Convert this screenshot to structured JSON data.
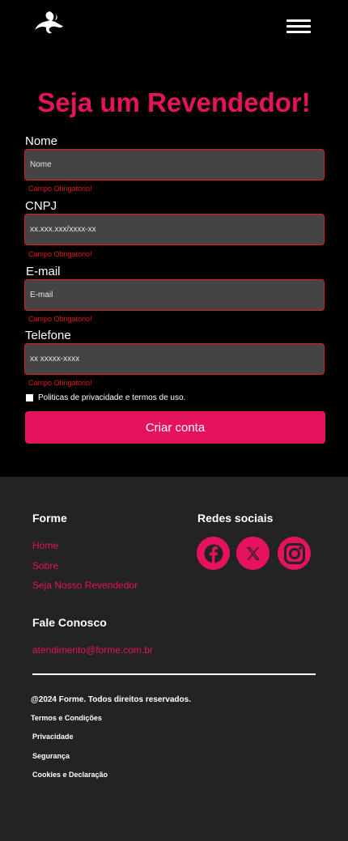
{
  "header": {
    "logo_icon": "brand-swirl-logo",
    "menu_icon": "hamburger-menu-icon"
  },
  "form": {
    "title": "Seja um Revendedor!",
    "fields": [
      {
        "label": "Nome",
        "placeholder": "Nome",
        "error": "Campo Obrigatório!"
      },
      {
        "label": "CNPJ",
        "placeholder": "xx.xxx.xxx/xxxx-xx",
        "error": "Campo Obrigatório!"
      },
      {
        "label": "E-mail",
        "placeholder": "E-mail",
        "error": "Campo Obrigatório!"
      },
      {
        "label": "Telefone",
        "placeholder": "xx xxxxx-xxxx",
        "error": "Campo Obrigatório!"
      }
    ],
    "privacy_label": "Politicas de privacidade e termos de uso.",
    "submit_label": "Criar conta"
  },
  "footer": {
    "brand_heading": "Forme",
    "links": [
      "Home",
      "Sobre",
      "Seja Nosso Revendedor"
    ],
    "social_heading": "Redes sociais",
    "social_icons": [
      "facebook-icon",
      "x-twitter-icon",
      "instagram-icon"
    ],
    "contact_heading": "Fale Conosco",
    "contact_email": "atendimento@forme.com.br",
    "copyright": "@2024 Forme. Todos direitos reservados.",
    "legal_links": [
      "Termos e Condições",
      "Privacidade",
      "Segurança",
      "Cookies e Declaração"
    ]
  },
  "colors": {
    "accent": "#e5125f",
    "error": "#e01c1c",
    "footer_bg": "#232323",
    "input_bg": "#444444"
  }
}
